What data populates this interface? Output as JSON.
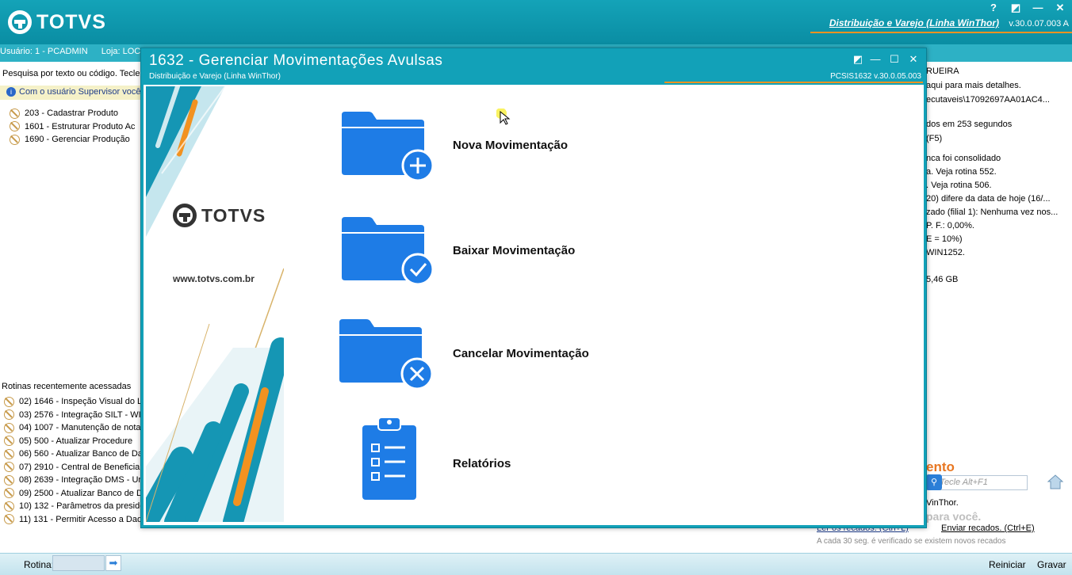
{
  "app": {
    "logo_text": "TOTVS",
    "product_name": "Distribuição e Varejo (Linha WinThor)",
    "version": "v.30.0.07.003 A",
    "top_icons": [
      "?",
      "◩",
      "—",
      "✕"
    ]
  },
  "userbar": {
    "usuario": "Usuário: 1 - PCADMIN",
    "loja": "Loja: LOC"
  },
  "left": {
    "search_hint": "Pesquisa por texto ou código. Tecle",
    "info": "Com o usuário Supervisor você",
    "tree": [
      "203 - Cadastrar  Produto",
      "1601 - Estruturar Produto Ac",
      "1690 - Gerenciar Produção"
    ],
    "recent_title": "Rotinas recentemente acessadas",
    "recent": [
      "02)  1646 - Inspeção Visual do L",
      "03)  2576 - Integração SILT - WI",
      "04)  1007 - Manutenção de nota",
      "05)  500 - Atualizar Procedure",
      "06)  560 - Atualizar Banco de Da",
      "07)  2910 - Central de Beneficiar",
      "08)  2639 - Integração DMS - Ur",
      "09)  2500 - Atualizar Banco de D",
      "10)  132 - Parâmetros da presidê",
      "11)  131 - Permitir Acesso a Dad"
    ]
  },
  "right": {
    "lines": [
      "RUEIRA",
      "aqui para mais detalhes.",
      "ecutaveis\\17092697AA01AC4...",
      "",
      "dos em 253 segundos",
      "(F5)",
      "",
      "nca foi consolidado",
      "a. Veja rotina 552.",
      ". Veja rotina 506.",
      "20) difere da data de hoje (16/...",
      "zado (filial 1): Nenhuma vez nos...",
      "P. F.: 0,00%.",
      "E = 10%)",
      "WIN1252.",
      "",
      "5,46 GB"
    ],
    "dash_label": "ento",
    "search_placeholder": "o. Tecle Alt+F1",
    "winthor": "VinThor.",
    "para_voce": "para você.",
    "ler_recados": "Ler os recados. (Ctrl+L)",
    "enviar_recados": "Enviar recados. (Ctrl+E)",
    "recados_note": "A cada 30 seg. é verificado se existem novos recados"
  },
  "bottom": {
    "rotina_label": "Rotina:",
    "reiniciar": "Reiniciar",
    "gravar": "Gravar"
  },
  "dialog": {
    "title": "1632 - Gerenciar Movimentações Avulsas",
    "subtitle": "Distribuição e Varejo (Linha WinThor)",
    "version": "PCSIS1632  v.30.0.05.003",
    "banner_logo": "TOTVS",
    "banner_url": "www.totvs.com.br",
    "menu": [
      {
        "label": "Nova Movimentação",
        "icon": "folder-plus-icon"
      },
      {
        "label": "Baixar Movimentação",
        "icon": "folder-check-icon"
      },
      {
        "label": "Cancelar Movimentação",
        "icon": "folder-x-icon"
      },
      {
        "label": "Relatórios",
        "icon": "clipboard-list-icon"
      }
    ]
  },
  "colors": {
    "teal": "#12a1b8",
    "orange": "#f29220",
    "icon_blue": "#1e7ce6"
  }
}
